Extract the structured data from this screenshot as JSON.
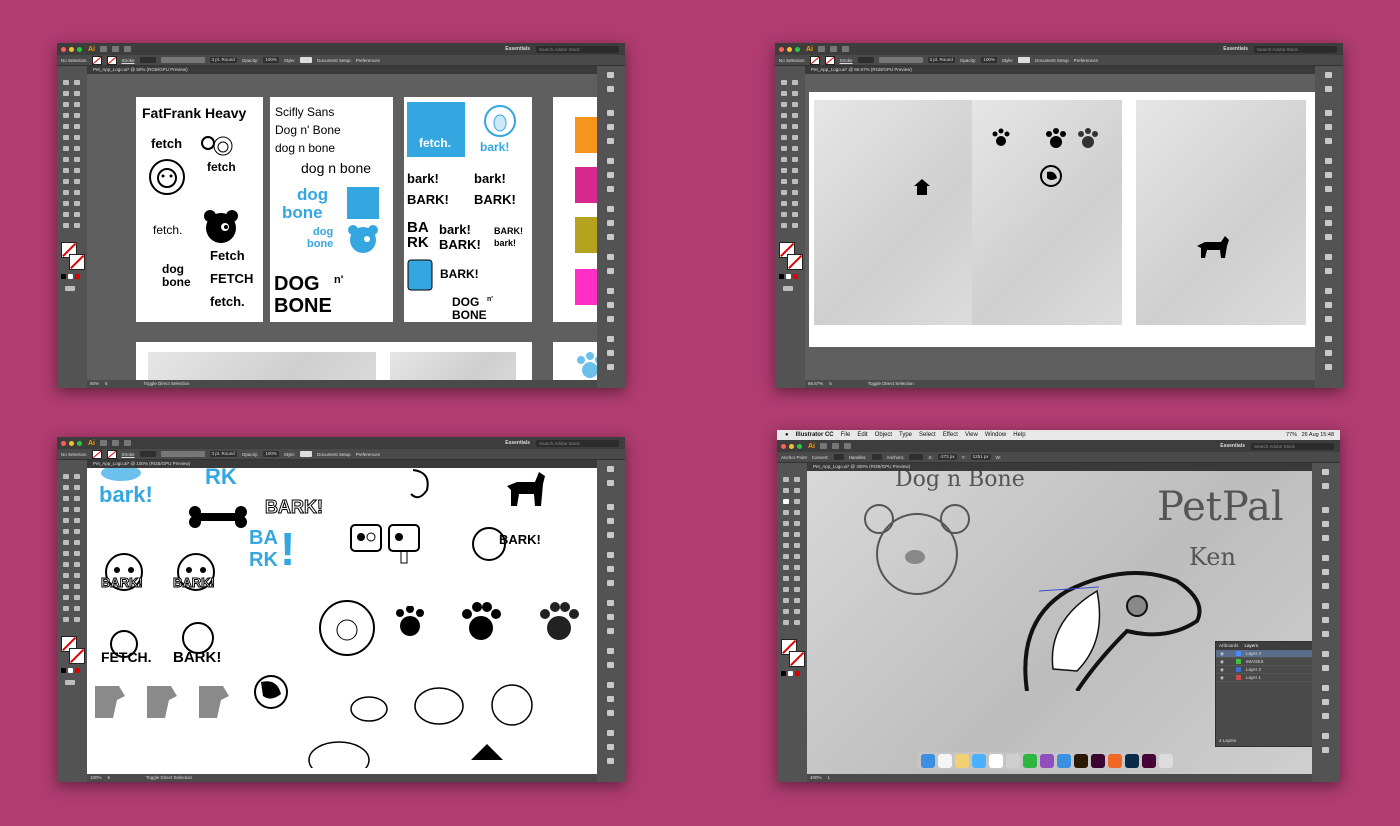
{
  "background_color": "#b03c70",
  "app": {
    "name": "Ai",
    "workspace": "Essentials",
    "search_placeholder": "Search Adobe Stock",
    "no_selection": "No Selection",
    "stroke_label": "Stroke",
    "brush_label": "3 pt. Round",
    "opacity_label": "Opacity:",
    "opacity_value": "100%",
    "style_label": "Style:",
    "document_setup": "Document Setup",
    "preferences": "Preferences",
    "status_tool": "Toggle Direct Selection"
  },
  "windows": [
    {
      "tab": "Pet_App_Logo.ai* @ 50% (RGB/GPU Preview)",
      "zoom": "50%",
      "page": "5"
    },
    {
      "tab": "Pet_App_Logo.ai* @ 66.67% (RGB/GPU Preview)",
      "zoom": "66.67%",
      "page": "5"
    },
    {
      "tab": "Pet_App_Logo.ai* @ 100% (RGB/GPU Preview)",
      "zoom": "100%",
      "page": "5"
    },
    {
      "tab": "Pet_App_Logo.ai* @ 400% (RGB/GPU Preview)",
      "zoom": "400%",
      "page": "1"
    }
  ],
  "artboard1": {
    "title": "FatFrank Heavy",
    "fetch_o": "fetch",
    "fetch_small": "fetch",
    "fetch_dot": "fetch.",
    "dog": "dog",
    "bone": "bone",
    "fetch_cap": "Fetch",
    "fetch_upper": "FETCH",
    "fetch_dot2": "fetch."
  },
  "artboard2": {
    "title": "Scifly Sans",
    "line1": "Dog n' Bone",
    "line2": "dog n bone",
    "line3": "dog n bone",
    "dog": "dog",
    "bone": "bone",
    "dog_small": "dog",
    "bone_small": "bone",
    "dog_heavy": "DOG",
    "n_heavy": "n'",
    "bone_heavy": "BONE"
  },
  "artboard3": {
    "fetch_badge": "fetch.",
    "bark_badge": "bark!",
    "bark1": "bark!",
    "bark2": "bark!",
    "bark3": "BARK!",
    "bark4": "BARK!",
    "ba": "BA",
    "rk": "RK",
    "bark5": "bark!",
    "bark6": "BARK!",
    "bark7": "BARK!",
    "bark8": "bark!",
    "bark9": "BARK!",
    "dog_n": "DOG",
    "n_mark": "n'",
    "bone_n": "BONE"
  },
  "window3": {
    "rk_top": "RK",
    "bark_blue": "bark!",
    "bark_outline": "BARK!",
    "ba": "BA",
    "rk": "RK",
    "bark_dog": "BARK!",
    "bark_badge1": "BARK!",
    "bark_badge2": "BARK!",
    "fetch": "FETCH.",
    "bark_big": "BARK!"
  },
  "window4": {
    "menubar": {
      "app": "Illustrator CC",
      "items": [
        "File",
        "Edit",
        "Object",
        "Type",
        "Select",
        "Effect",
        "View",
        "Window",
        "Help"
      ],
      "status": "77%",
      "datetime": "26 Aug 15:48"
    },
    "anchor_bar": {
      "anchor_point": "Anchor Point",
      "convert": "Convert:",
      "handles": "Handles:",
      "anchors": "Anchors:",
      "x_label": "X:",
      "x_value": "-273 px",
      "y_label": "Y:",
      "y_value": "1251 px",
      "w_label": "W:"
    },
    "sketch_text": {
      "top": "Dog n Bone",
      "petpal": "PetPal",
      "ken": "Ken"
    },
    "layers_panel": {
      "tabs": [
        "Artboards",
        "Layers"
      ],
      "layers": [
        {
          "name": "Layer 4",
          "color": "#4a8bff",
          "selected": true
        },
        {
          "name": "IMAGES",
          "color": "#3fbf3f",
          "selected": false
        },
        {
          "name": "Layer 2",
          "color": "#3a6fd0",
          "selected": false
        },
        {
          "name": "Layer 1",
          "color": "#d04a4a",
          "selected": false
        }
      ],
      "count": "4 Layers"
    }
  },
  "accent_colors": {
    "blue": "#35a7e0",
    "orange": "#f7941d",
    "magenta": "#d8288f",
    "olive": "#b5a21f",
    "pink": "#ff2ec4"
  }
}
